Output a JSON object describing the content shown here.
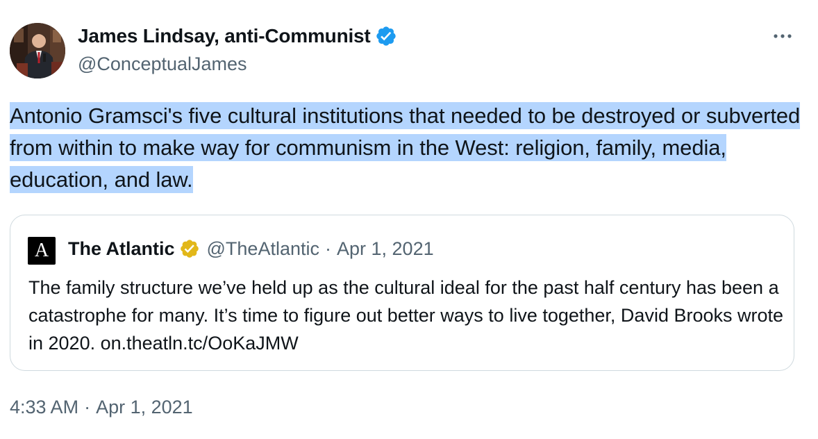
{
  "author": {
    "name": "James Lindsay, anti-Communist",
    "handle": "@ConceptualJames",
    "verified_icon": "verified-badge-blue",
    "verified_color": "#1d9bf0"
  },
  "tweet": {
    "text": "Antonio Gramsci's five cultural institutions that needed to be destroyed or subverted from within to make way for communism in the West: religion, family, media, education, and law.",
    "selection_color": "#b4d5fe"
  },
  "quote": {
    "logo_letter": "A",
    "name": "The Atlantic",
    "verified_icon": "verified-badge-gold",
    "verified_color": "#e2b719",
    "handle": "@TheAtlantic",
    "separator": "·",
    "date": "Apr 1, 2021",
    "text": "The family structure we’ve held up as the cultural ideal for the past half century has been a catastrophe for many. It’s time to figure out better ways to live together, David Brooks wrote in 2020. on.theatln.tc/OoKaJMW"
  },
  "footer": {
    "time": "4:33 AM",
    "separator": "·",
    "date": "Apr 1, 2021"
  },
  "colors": {
    "text": "#0f1419",
    "secondary": "#536471",
    "border": "#cfd9de"
  }
}
